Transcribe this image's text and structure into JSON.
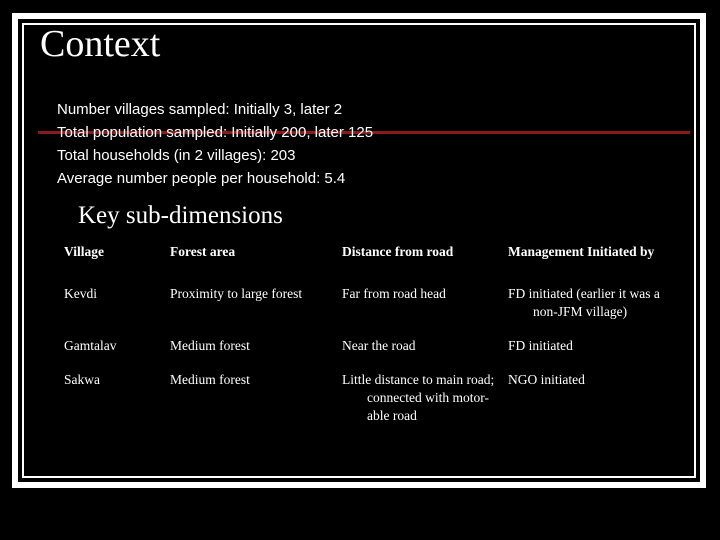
{
  "slide": {
    "title": "Context",
    "background_color": "#000000",
    "text_color": "#ffffff",
    "accent_color": "#8b1a1a"
  },
  "context": {
    "lines": [
      "Number villages sampled: Initially 3, later 2",
      "Total population sampled: Initially 200, later 125",
      "Total households (in 2 villages): 203",
      "Average number people per household: 5.4"
    ]
  },
  "subheading": "Key sub-dimensions",
  "table": {
    "headers": [
      "Village",
      "Forest area",
      "Distance from road",
      "Management Initiated by"
    ],
    "rows": [
      {
        "village": "Kevdi",
        "forest_area": "Proximity to large forest",
        "distance_from_road": "Far from road head",
        "management_initiated_by": "FD initiated (earlier it was a non-JFM village)"
      },
      {
        "village": "Gamtalav",
        "forest_area": "Medium forest",
        "distance_from_road": "Near the road",
        "management_initiated_by": "FD initiated"
      },
      {
        "village": "Sakwa",
        "forest_area": "Medium forest",
        "distance_from_road": "Little distance to main road; connected with motor-able road",
        "management_initiated_by": "NGO initiated"
      }
    ]
  }
}
